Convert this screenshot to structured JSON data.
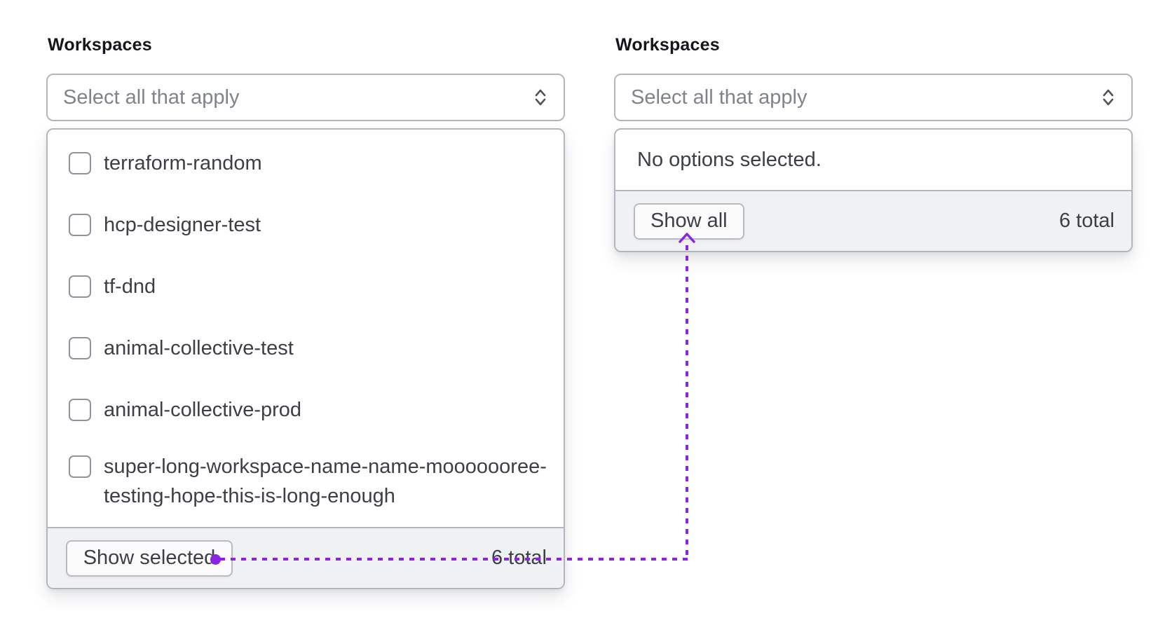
{
  "left_combobox": {
    "label": "Workspaces",
    "trigger": {
      "placeholder": "Select all that apply"
    },
    "options": [
      {
        "label": "terraform-random",
        "checked": false
      },
      {
        "label": "hcp-designer-test",
        "checked": false
      },
      {
        "label": "tf-dnd",
        "checked": false
      },
      {
        "label": "animal-collective-test",
        "checked": false
      },
      {
        "label": "animal-collective-prod",
        "checked": false
      },
      {
        "label": "super-long-workspace-name-name-mooooooree-testing-hope-this-is-long-enough",
        "checked": false
      }
    ],
    "footer": {
      "toggle_label": "Show selected",
      "total": "6 total"
    }
  },
  "right_combobox": {
    "label": "Workspaces",
    "trigger": {
      "placeholder": "Select all that apply"
    },
    "empty_message": "No options selected.",
    "footer": {
      "toggle_label": "Show all",
      "total": "6 total"
    }
  },
  "icons": {
    "trigger_icon": "chevrons-up-down",
    "annotation_arrow_icon": "chevron-up-arrow"
  },
  "colors": {
    "accent": "#8b24e3",
    "border": "#b3b6bd",
    "footer_bg": "#f0f1f3",
    "text_primary": "#3c3f46",
    "text_strong": "#14161b",
    "placeholder": "#7f838c",
    "checkbox_border": "#8f939b",
    "button_bg": "#fbfbfc",
    "button_border": "#b8bbc2"
  }
}
